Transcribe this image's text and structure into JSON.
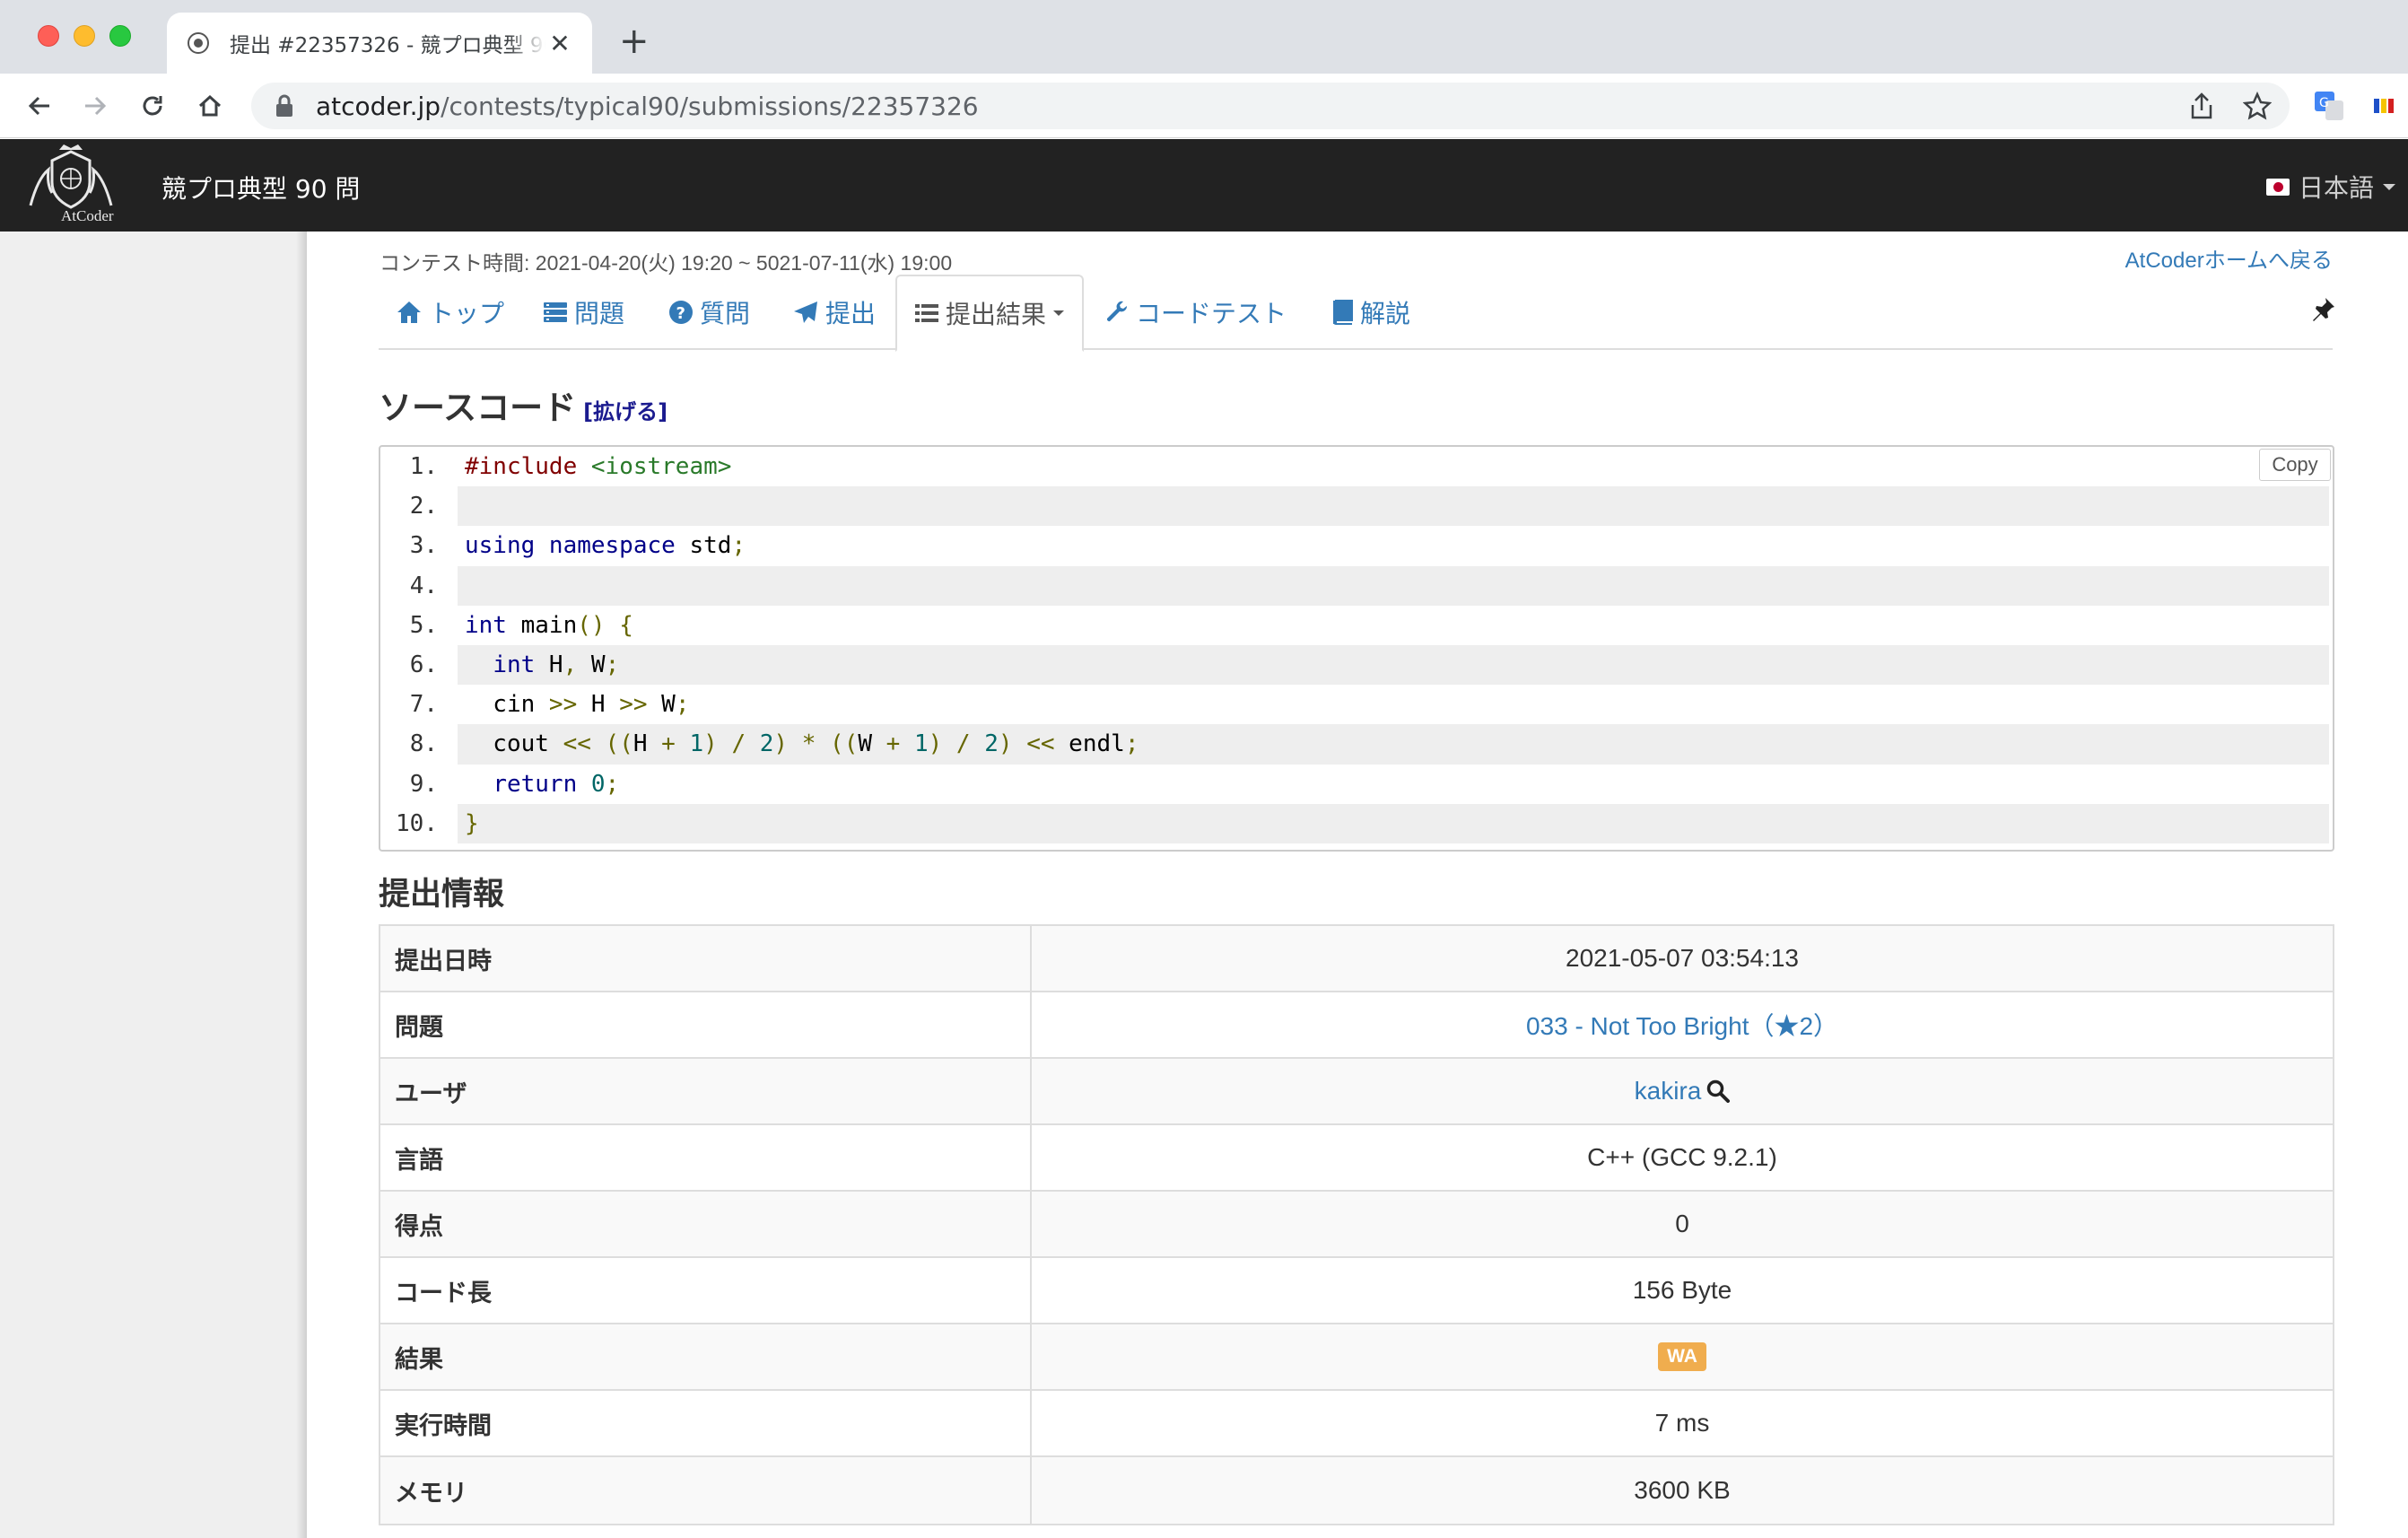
{
  "browser": {
    "tab_title": "提出 #22357326 - 競プロ典型 90 問",
    "url_host": "atcoder.jp",
    "url_path": "/contests/typical90/submissions/22357326"
  },
  "site": {
    "logo_text": "AtCoder",
    "contest_name": "競プロ典型 90 問",
    "language": "日本語"
  },
  "page": {
    "contest_time": "コンテスト時間: 2021-04-20(火) 19:20 ~ 5021-07-11(水) 19:00",
    "home_link": "AtCoderホームへ戻る",
    "tabs": [
      {
        "label": "トップ",
        "icon": "home-icon"
      },
      {
        "label": "問題",
        "icon": "list-icon"
      },
      {
        "label": "質問",
        "icon": "question-icon"
      },
      {
        "label": "提出",
        "icon": "send-icon"
      },
      {
        "label": "提出結果",
        "icon": "list-icon",
        "active": true
      },
      {
        "label": "コードテスト",
        "icon": "wrench-icon"
      },
      {
        "label": "解説",
        "icon": "book-icon"
      }
    ],
    "source_heading": "ソースコード",
    "expand_link": "[拡げる]",
    "copy_label": "Copy",
    "info_heading": "提出情報"
  },
  "code": {
    "line_numbers": [
      "1.",
      "2.",
      "3.",
      "4.",
      "5.",
      "6.",
      "7.",
      "8.",
      "9.",
      "10."
    ],
    "lines": [
      "#include <iostream>",
      "",
      "using namespace std;",
      "",
      "int main() {",
      "  int H, W;",
      "  cin >> H >> W;",
      "  cout << ((H + 1) / 2) * ((W + 1) / 2) << endl;",
      "  return 0;",
      "}"
    ]
  },
  "submission": {
    "rows": [
      {
        "label": "提出日時",
        "value": "2021-05-07 03:54:13"
      },
      {
        "label": "問題",
        "value": "033 - Not Too Bright（★2）"
      },
      {
        "label": "ユーザ",
        "value": "kakira"
      },
      {
        "label": "言語",
        "value": "C++ (GCC 9.2.1)"
      },
      {
        "label": "得点",
        "value": "0"
      },
      {
        "label": "コード長",
        "value": "156 Byte"
      },
      {
        "label": "結果",
        "value": "WA"
      },
      {
        "label": "実行時間",
        "value": "7 ms"
      },
      {
        "label": "メモリ",
        "value": "3600 KB"
      }
    ]
  },
  "colors": {
    "navbar": "#222222",
    "link": "#337ab7",
    "wa_badge": "#f0ad4e"
  }
}
